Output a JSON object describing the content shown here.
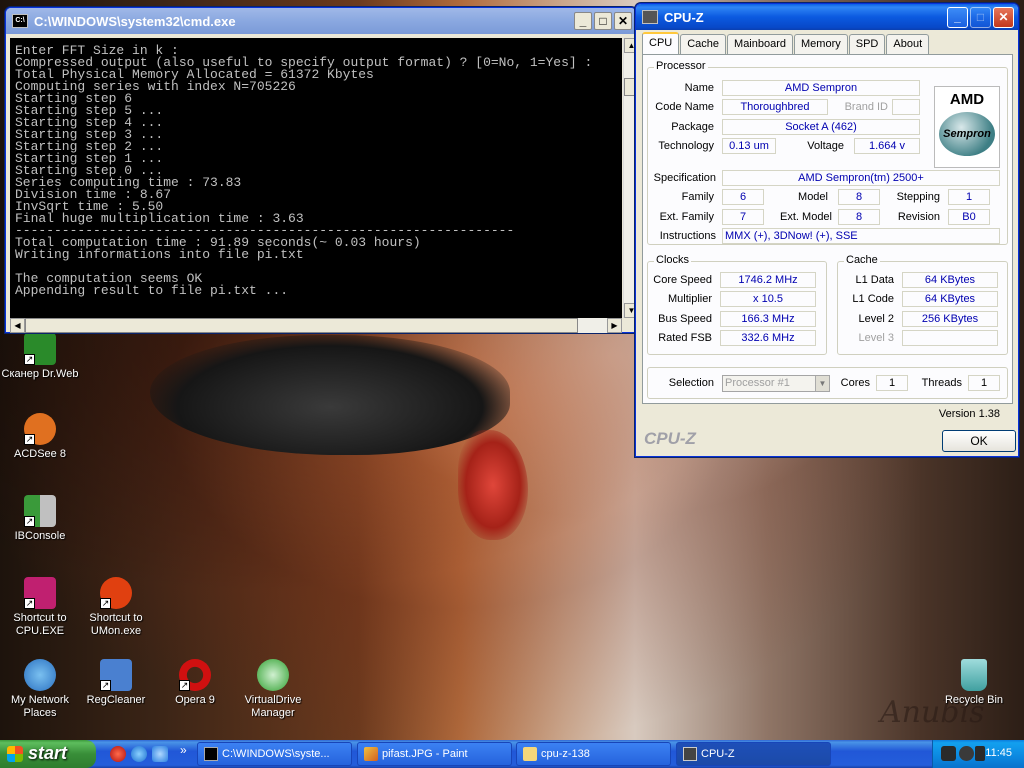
{
  "cmd": {
    "title": "C:\\WINDOWS\\system32\\cmd.exe",
    "output": "Enter FFT Size in k :\nCompressed output (also useful to specify output format) ? [0=No, 1=Yes] :\nTotal Physical Memory Allocated = 61372 Kbytes\nComputing series with index N=705226\nStarting step 6\nStarting step 5 ...\nStarting step 4 ...\nStarting step 3 ...\nStarting step 2 ...\nStarting step 1 ...\nStarting step 0 ...\nSeries computing time : 73.83\nDivision time : 8.67\nInvSqrt time : 5.50\nFinal huge multiplication time : 3.63\n----------------------------------------------------------------\nTotal computation time : 91.89 seconds(~ 0.03 hours)\nWriting informations into file pi.txt\n\nThe computation seems OK\nAppending result to file pi.txt ..."
  },
  "cpuz": {
    "title": "CPU-Z",
    "tabs": [
      "CPU",
      "Cache",
      "Mainboard",
      "Memory",
      "SPD",
      "About"
    ],
    "processor": {
      "legend": "Processor",
      "name_label": "Name",
      "name": "AMD Sempron",
      "codename_label": "Code Name",
      "codename": "Thoroughbred",
      "brandid_label": "Brand ID",
      "brandid": "",
      "package_label": "Package",
      "package": "Socket A (462)",
      "technology_label": "Technology",
      "technology": "0.13 um",
      "voltage_label": "Voltage",
      "voltage": "1.664 v",
      "spec_label": "Specification",
      "spec": "AMD Sempron(tm)  2500+",
      "family_label": "Family",
      "family": "6",
      "model_label": "Model",
      "model": "8",
      "stepping_label": "Stepping",
      "stepping": "1",
      "extfamily_label": "Ext. Family",
      "extfamily": "7",
      "extmodel_label": "Ext. Model",
      "extmodel": "8",
      "revision_label": "Revision",
      "revision": "B0",
      "instructions_label": "Instructions",
      "instructions": "MMX (+), 3DNow! (+), SSE",
      "logo_top": "AMD",
      "logo_bottom": "Sempron"
    },
    "clocks": {
      "legend": "Clocks",
      "corespeed_label": "Core Speed",
      "corespeed": "1746.2 MHz",
      "multiplier_label": "Multiplier",
      "multiplier": "x 10.5",
      "busspeed_label": "Bus Speed",
      "busspeed": "166.3 MHz",
      "ratedfsb_label": "Rated FSB",
      "ratedfsb": "332.6 MHz"
    },
    "cache": {
      "legend": "Cache",
      "l1data_label": "L1 Data",
      "l1data": "64 KBytes",
      "l1code_label": "L1 Code",
      "l1code": "64 KBytes",
      "level2_label": "Level 2",
      "level2": "256 KBytes",
      "level3_label": "Level 3",
      "level3": ""
    },
    "selection_label": "Selection",
    "selection": "Processor #1",
    "cores_label": "Cores",
    "cores": "1",
    "threads_label": "Threads",
    "threads": "1",
    "version": "Version 1.38",
    "brand": "CPU-Z",
    "ok_label": "OK"
  },
  "desktop_icons": [
    {
      "label": "Сканер Dr.Web",
      "color": "#2a8a2a"
    },
    {
      "label": "ACDSee 8",
      "color": "#e07020"
    },
    {
      "label": "IBConsole",
      "color": "#3a9a3a"
    },
    {
      "label": "Shortcut to CPU.EXE",
      "color": "#c02070"
    },
    {
      "label": "Shortcut to UMon.exe",
      "color": "#e04010"
    },
    {
      "label": "My Network Places",
      "color": "#2a70c0"
    },
    {
      "label": "RegCleaner",
      "color": "#4a80d0"
    },
    {
      "label": "Opera 9",
      "color": "#d01010"
    },
    {
      "label": "VirtualDrive Manager",
      "color": "#30a030"
    },
    {
      "label": "Recycle Bin",
      "color": "#40a0a0"
    }
  ],
  "wallpaper_signature": "Anubis",
  "taskbar": {
    "start_label": "start",
    "tasks": [
      {
        "label": "C:\\WINDOWS\\syste..."
      },
      {
        "label": "pifast.JPG - Paint"
      },
      {
        "label": "cpu-z-138"
      },
      {
        "label": "CPU-Z"
      }
    ],
    "quicklaunch_more": "»",
    "clock": "11:45"
  }
}
